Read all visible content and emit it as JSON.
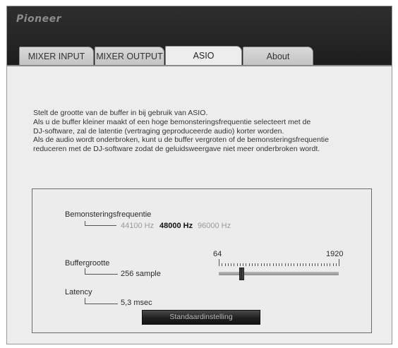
{
  "app": {
    "logo": "Pioneer"
  },
  "tabs": [
    {
      "label": "MIXER INPUT"
    },
    {
      "label": "MIXER OUTPUT"
    },
    {
      "label": "ASIO"
    },
    {
      "label": "About"
    }
  ],
  "active_tab": "ASIO",
  "description": [
    "Stelt de grootte van de buffer in bij gebruik van ASIO.",
    "Als u de buffer kleiner maakt of een hoge bemonsteringsfrequentie selecteert met de",
    "DJ-software, zal de latentie (vertraging geproduceerde audio) korter worden.",
    "Als de audio wordt onderbroken, kunt u de buffer vergroten of de bemonsteringsfrequentie",
    "reduceren met de DJ-software zodat de geluidsweergave niet meer onderbroken wordt."
  ],
  "sample_rate": {
    "label": "Bemonsteringsfrequentie",
    "options": [
      "44100 Hz",
      "48000 Hz",
      "96000 Hz"
    ],
    "selected": "48000 Hz"
  },
  "buffer": {
    "label": "Buffergrootte",
    "value_text": "256 sample",
    "min_label": "64",
    "max_label": "1920",
    "min": 64,
    "max": 1920,
    "value": 256
  },
  "latency": {
    "label": "Latency",
    "value_text": "5,3 msec"
  },
  "reset_button": {
    "label": "Standaardinstelling"
  }
}
